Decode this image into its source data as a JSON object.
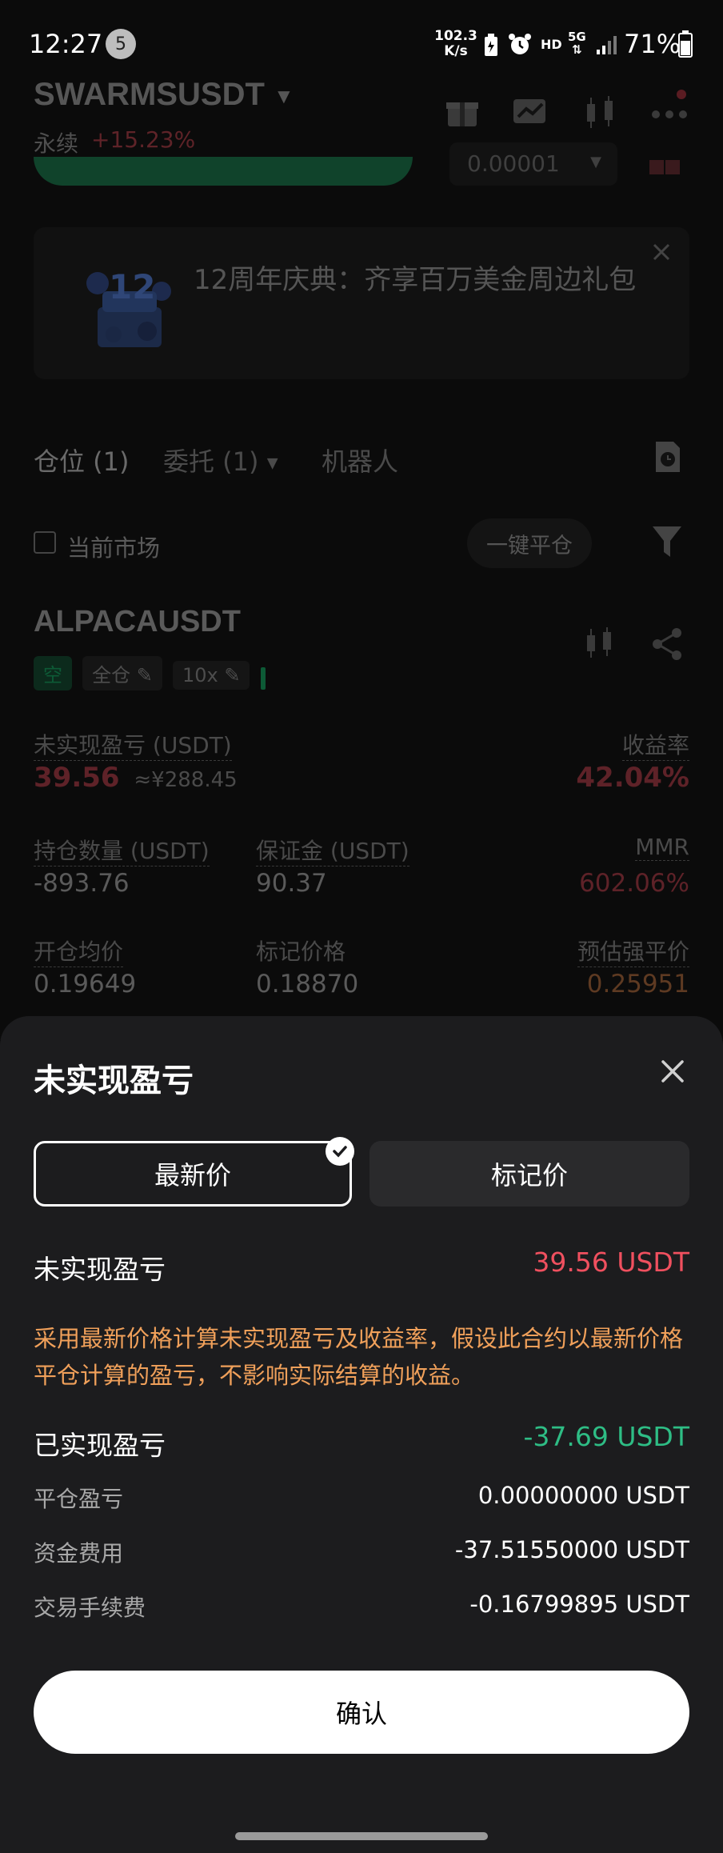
{
  "status_bar": {
    "time": "12:27",
    "notif_count": "5",
    "net_speed": "102.3",
    "net_unit": "K/s",
    "hd": "HD",
    "signal": "5G",
    "battery": "71%"
  },
  "header": {
    "symbol": "SWARMSUSDT",
    "type": "永续",
    "change": "+15.23%",
    "price_step": "0.00001"
  },
  "banner": {
    "text": "12周年庆典：齐享百万美金周边礼包",
    "badge": "12"
  },
  "tabs": {
    "positions": "仓位 (1)",
    "orders": "委托 (1)",
    "bots": "机器人"
  },
  "filters": {
    "current_market": "当前市场",
    "close_all": "一键平仓"
  },
  "position": {
    "symbol": "ALPACAUSDT",
    "side": "空",
    "margin_mode": "全仓",
    "leverage": "10x",
    "upnl_label": "未实现盈亏 (USDT)",
    "upnl_value": "39.56",
    "upnl_cny": "≈¥288.45",
    "roe_label": "收益率",
    "roe_value": "42.04%",
    "qty_label": "持仓数量 (USDT)",
    "qty_value": "-893.76",
    "margin_label": "保证金 (USDT)",
    "margin_value": "90.37",
    "mmr_label": "MMR",
    "mmr_value": "602.06%",
    "entry_label": "开仓均价",
    "entry_value": "0.19649",
    "mark_label": "标记价格",
    "mark_value": "0.18870",
    "liq_label": "预估强平价",
    "liq_value": "0.25951"
  },
  "sheet": {
    "title": "未实现盈亏",
    "tab_latest": "最新价",
    "tab_mark": "标记价",
    "upnl_label": "未实现盈亏",
    "upnl_value": "39.56 USDT",
    "note": "采用最新价格计算未实现盈亏及收益率，假设此合约以最新价格平仓计算的盈亏，不影响实际结算的收益。",
    "realized_label": "已实现盈亏",
    "realized_value": "-37.69 USDT",
    "rows": [
      {
        "label": "平仓盈亏",
        "value": "0.00000000 USDT"
      },
      {
        "label": "资金费用",
        "value": "-37.51550000 USDT"
      },
      {
        "label": "交易手续费",
        "value": "-0.16799895 USDT"
      }
    ],
    "confirm": "确认"
  },
  "colors": {
    "red": "#f0505f",
    "green": "#2ebd85",
    "orange": "#f0a05a",
    "sheet_bg": "#1c1c1e"
  }
}
